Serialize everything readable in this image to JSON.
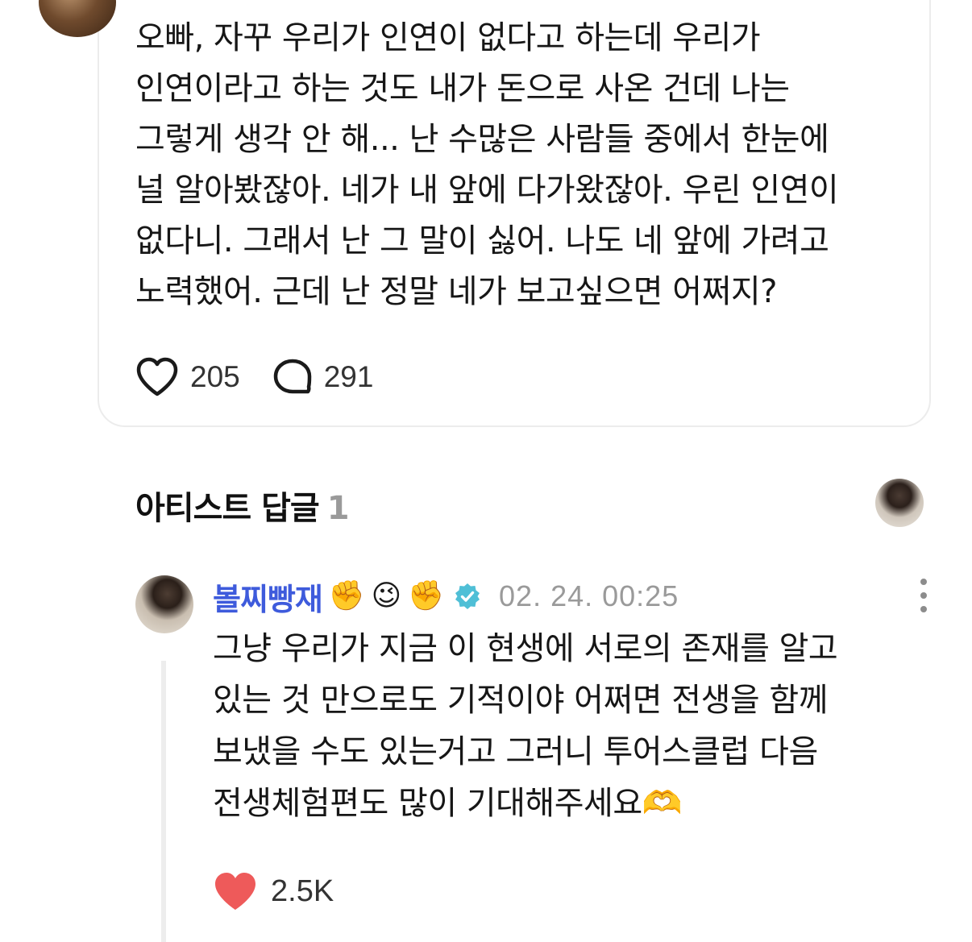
{
  "post": {
    "lines": [
      "오빠, 자꾸 우리가 인연이 없다고 하는데 우리가",
      "인연이라고 하는 것도 내가 돈으로 사온 건데 나는",
      "그렇게 생각 안 해... 난 수많은 사람들 중에서 한눈에",
      "널 알아봤잖아. 네가 내 앞에 다가왔잖아. 우린 인연이",
      "없다니. 그래서 난 그 말이 싫어. 나도 네 앞에 가려고",
      "노력했어. 근데 난 정말 네가 보고싶으면 어쩌지?"
    ],
    "likes": "205",
    "comments": "291"
  },
  "section": {
    "title": "아티스트 답글",
    "count": "1"
  },
  "reply": {
    "author": "볼찌빵재",
    "emojis": [
      "✊",
      "😉",
      "✊"
    ],
    "timestamp": "02. 24. 00:25",
    "lines": [
      "그냥 우리가 지금 이 현생에 서로의 존재를 알고",
      "있는 것 만으로도 기적이야 어쩌면 전생을 함께",
      "보냈을 수도 있는거고 그러니 투어스클럽 다음",
      "전생체험편도 많이 기대해주세요🫶"
    ],
    "likes": "2.5K",
    "like_color": "#ee5a5a",
    "author_color": "#3e5bdc",
    "verified_color": "#4fbfd6"
  }
}
